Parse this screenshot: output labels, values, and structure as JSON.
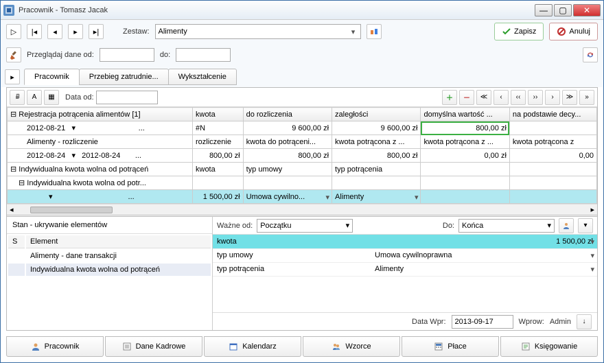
{
  "titlebar": {
    "title": "Pracownik - Tomasz Jacak"
  },
  "toolbar": {
    "zestaw_label": "Zestaw:",
    "zestaw_value": "Alimenty",
    "save_label": "Zapisz",
    "cancel_label": "Anuluj",
    "browse_label": "Przeglądaj dane od:",
    "browse_to": "do:"
  },
  "tabs": {
    "t1": "Pracownik",
    "t2": "Przebieg zatrudnie...",
    "t3": "Wykształcenie"
  },
  "mini": {
    "data_od_label": "Data od:"
  },
  "grid": {
    "headers": {
      "tree": "Rejestracja potrącenia alimentów [1]",
      "c1": "kwota",
      "c2": "do rozliczenia",
      "c3": "zaległości",
      "c4": "domyślna wartość ...",
      "c5": "na podstawie decy..."
    },
    "r1_date": "2012-08-21",
    "r1_c1": "#N",
    "r1_c2": "9 600,00 zł",
    "r1_c3": "9 600,00 zł",
    "r1_c4": "800,00 zł",
    "r2_tree": "Alimenty - rozliczenie",
    "r2_c1": "rozliczenie",
    "r2_c2": "kwota do potrąceni...",
    "r2_c3": "kwota potrącona z ...",
    "r2_c4": "kwota potrącona z ...",
    "r2_c5": "kwota potrącona z",
    "r3_date": "2012-08-24",
    "r3_date2": "2012-08-24",
    "r3_c1": "800,00 zł",
    "r3_c2": "800,00 zł",
    "r3_c3": "800,00 zł",
    "r3_c4": "0,00 zł",
    "r3_c5": "0,00",
    "r4_tree": "Indywidualna kwota wolna od potrąceń",
    "r4_c1": "kwota",
    "r4_c2": "typ umowy",
    "r4_c3": "typ potrącenia",
    "r5_tree": "Indywidualna kwota wolna od potr...",
    "r6_c1": "1 500,00 zł",
    "r6_c2": "Umowa cywilno...",
    "r6_c3": "Alimenty"
  },
  "left": {
    "header": "Stan - ukrywanie elementów",
    "col_s": "S",
    "col_el": "Element",
    "row1": "Alimenty - dane transakcji",
    "row2": "Indywidualna kwota wolna od potrąceń"
  },
  "right": {
    "wazne_od": "Ważne od:",
    "wazne_od_val": "Początku",
    "do": "Do:",
    "do_val": "Końca",
    "p1_name": "kwota",
    "p1_val": "1 500,00 zł",
    "p2_name": "typ umowy",
    "p2_val": "Umowa cywilnoprawna",
    "p3_name": "typ potrącenia",
    "p3_val": "Alimenty"
  },
  "footer": {
    "data_wpr": "Data Wpr:",
    "data_wpr_val": "2013-09-17",
    "wprow": "Wprow:",
    "wprow_val": "Admin"
  },
  "bottom_tabs": {
    "t1": "Pracownik",
    "t2": "Dane Kadrowe",
    "t3": "Kalendarz",
    "t4": "Wzorce",
    "t5": "Płace",
    "t6": "Księgowanie"
  }
}
